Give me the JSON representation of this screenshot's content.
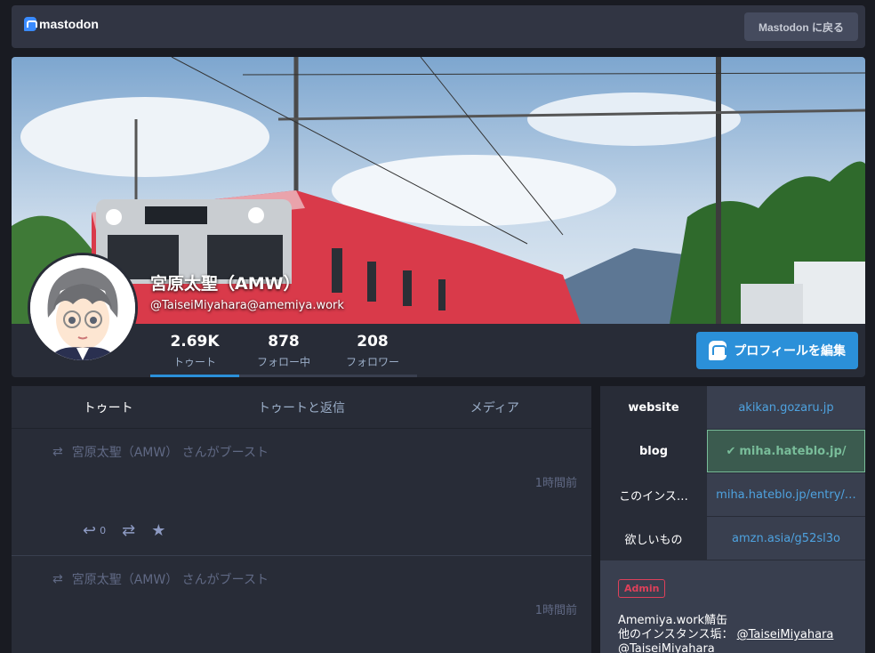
{
  "topbar": {
    "logo_text": "mastodon",
    "back_label": "Mastodon に戻る"
  },
  "profile": {
    "display_name": "宮原太聖（AMW）",
    "acct": "@TaiseiMiyahara@amemiya.work",
    "counters": [
      {
        "num": "2.69K",
        "label": "トゥート"
      },
      {
        "num": "878",
        "label": "フォロー中"
      },
      {
        "num": "208",
        "label": "フォロワー"
      }
    ],
    "edit_label": "プロフィールを編集"
  },
  "tabs": [
    "トゥート",
    "トゥートと返信",
    "メディア"
  ],
  "statuses": [
    {
      "boost_text": "宮原太聖（AMW） さんがブースト",
      "time": "1時間前",
      "reply_count": "0"
    },
    {
      "boost_text": "宮原太聖（AMW） さんがブースト",
      "time": "1時間前"
    }
  ],
  "fields": [
    {
      "name": "website",
      "value": "akikan.gozaru.jp"
    },
    {
      "name": "blog",
      "value": "miha.hateblo.jp/"
    },
    {
      "name": "このインス…",
      "value": "miha.hateblo.jp/entry/…"
    },
    {
      "name": "欲しいもの",
      "value": "amzn.asia/g52sl3o"
    }
  ],
  "bio": {
    "badge": "Admin",
    "line1": "Amemiya.work鯖缶",
    "line2_prefix": "他のインスタンス垢：",
    "line2_link": "@TaiseiMiyahara",
    "line3": "@TaiseiMiyahara"
  },
  "colors": {
    "accent": "#2b90d9",
    "verified": "#79bd9a",
    "admin": "#df405a"
  }
}
